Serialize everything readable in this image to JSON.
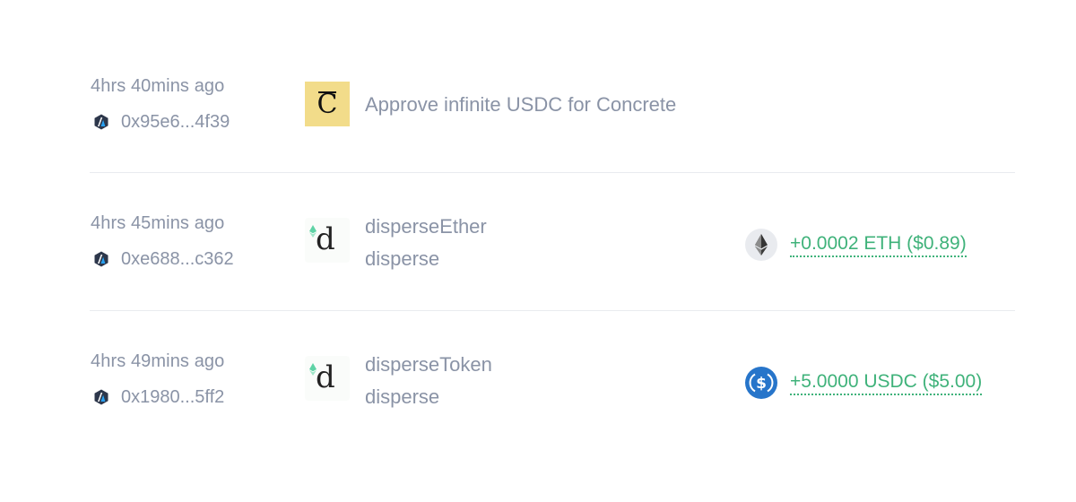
{
  "transactions": [
    {
      "time": "4hrs 40mins ago",
      "address": "0x95e6...4f39",
      "network_icon": "arbitrum-icon",
      "app_icon": "concrete-logo",
      "title": "Approve infinite USDC for Concrete"
    },
    {
      "time": "4hrs 45mins ago",
      "address": "0xe688...c362",
      "network_icon": "arbitrum-icon",
      "app_icon": "disperse-logo",
      "method": "disperseEther",
      "contract": "disperse",
      "token_icon": "eth-icon",
      "change": "+0.0002 ETH ($0.89)"
    },
    {
      "time": "4hrs 49mins ago",
      "address": "0x1980...5ff2",
      "network_icon": "arbitrum-icon",
      "app_icon": "disperse-logo",
      "method": "disperseToken",
      "contract": "disperse",
      "token_icon": "usdc-icon",
      "change": "+5.0000 USDC ($5.00)"
    }
  ],
  "logo_glyphs": {
    "concrete": "C",
    "disperse": "d"
  },
  "colors": {
    "text_muted": "#8a93a6",
    "positive": "#3fb27a",
    "concrete_bg": "#f2dc8a",
    "usdc_blue": "#2775ca",
    "divider": "#e9ebef"
  }
}
